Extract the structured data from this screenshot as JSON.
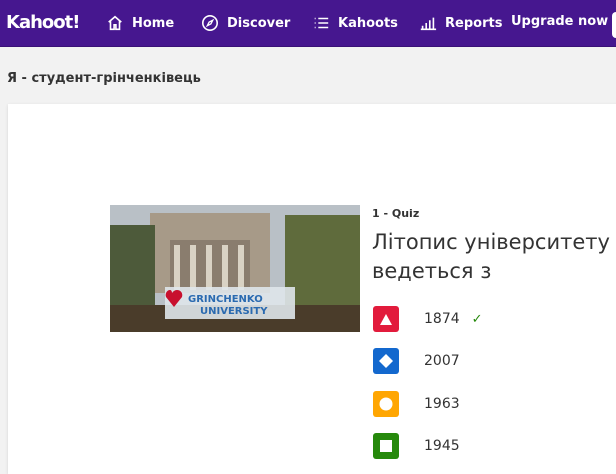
{
  "header": {
    "logo": "Kahoot!",
    "nav": [
      {
        "label": "Home",
        "icon": "home-icon"
      },
      {
        "label": "Discover",
        "icon": "compass-icon"
      },
      {
        "label": "Kahoots",
        "icon": "list-icon"
      },
      {
        "label": "Reports",
        "icon": "bar-chart-icon"
      }
    ],
    "upgrade": "Upgrade now"
  },
  "page": {
    "title": "Я - студент-грінченківець"
  },
  "question": {
    "number": "1 - Quiz",
    "text": "Літопис університету ведеться з",
    "image_sign": "GRINCHENKO UNIVERSITY",
    "answers": [
      {
        "text": "1874",
        "shape": "triangle",
        "color": "#e21b3c",
        "correct": true
      },
      {
        "text": "2007",
        "shape": "diamond",
        "color": "#1368ce",
        "correct": false
      },
      {
        "text": "1963",
        "shape": "circle",
        "color": "#ffa602",
        "correct": false
      },
      {
        "text": "1945",
        "shape": "square",
        "color": "#26890c",
        "correct": false
      }
    ]
  },
  "colors": {
    "header": "#46178f",
    "check": "#26890c"
  }
}
